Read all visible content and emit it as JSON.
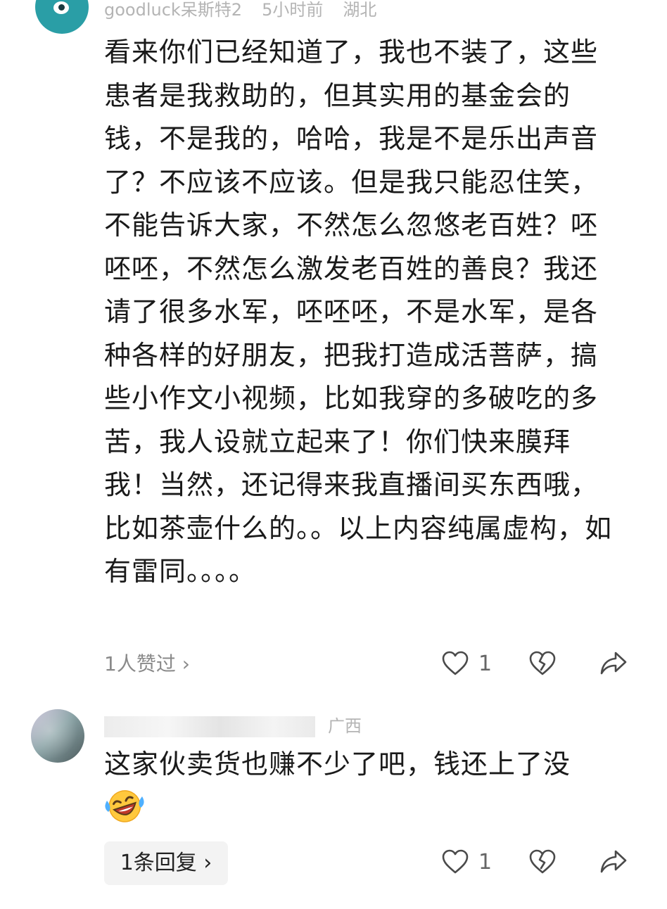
{
  "comments": [
    {
      "meta": {
        "username": "goodluck呆斯特2",
        "time": "5小时前",
        "location": "湖北"
      },
      "text": "看来你们已经知道了，我也不装了，这些患者是我救助的，但其实用的基金会的钱，不是我的，哈哈，我是不是乐出声音了？不应该不应该。但是我只能忍住笑，不能告诉大家，不然怎么忽悠老百姓？呸呸呸，不然怎么激发老百姓的善良？我还请了很多水军，呸呸呸，不是水军，是各种各样的好朋友，把我打造成活菩萨，搞些小作文小视频，比如我穿的多破吃的多苦，我人设就立起来了！你们快来膜拜我！当然，还记得来我直播间买东西哦，比如茶壶什么的。。以上内容纯属虚构，如有雷同。。。。",
      "likes_link": "1人赞过 ›",
      "like_count": "1",
      "icons": {
        "like": "heart-outline-icon",
        "dislike": "broken-heart-icon",
        "share": "share-arrow-icon"
      }
    },
    {
      "meta": {
        "location": "广西"
      },
      "text": "这家伙卖货也赚不少了吧，钱还上了没",
      "emoji": "laughing-crying-emoji",
      "reply_link": "1条回复 ›",
      "like_count": "1",
      "icons": {
        "like": "heart-outline-icon",
        "dislike": "broken-heart-icon",
        "share": "share-arrow-icon"
      }
    }
  ]
}
